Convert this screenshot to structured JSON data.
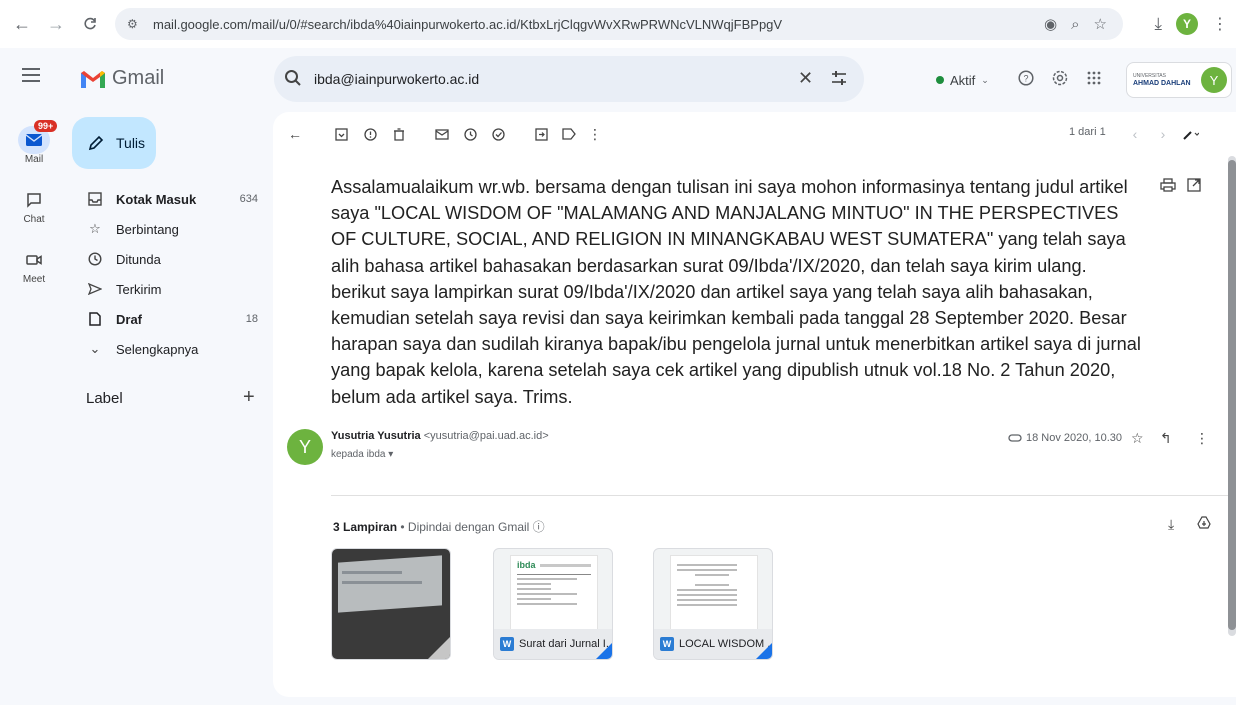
{
  "browser": {
    "url": "mail.google.com/mail/u/0/#search/ibda%40iainpurwokerto.ac.id/KtbxLrjClqgvWvXRwPRWNcVLNWqjFBPpgV",
    "profile_initial": "Y"
  },
  "header": {
    "app_name": "Gmail",
    "search_query": "ibda@iainpurwokerto.ac.id",
    "status": "Aktif",
    "brand_line1": "UNIVERSITAS",
    "brand_line2": "AHMAD DAHLAN",
    "avatar_initial": "Y"
  },
  "rail": {
    "mail_label": "Mail",
    "mail_badge": "99+",
    "chat_label": "Chat",
    "meet_label": "Meet"
  },
  "sidebar": {
    "compose_label": "Tulis",
    "items": [
      {
        "label": "Kotak Masuk",
        "count": "634",
        "icon": "inbox-icon"
      },
      {
        "label": "Berbintang",
        "count": "",
        "icon": "star-icon"
      },
      {
        "label": "Ditunda",
        "count": "",
        "icon": "clock-icon"
      },
      {
        "label": "Terkirim",
        "count": "",
        "icon": "send-icon"
      },
      {
        "label": "Draf",
        "count": "18",
        "icon": "draft-icon"
      },
      {
        "label": "Selengkapnya",
        "count": "",
        "icon": "chevron-down-icon"
      }
    ],
    "label_heading": "Label"
  },
  "toolbar": {
    "pager": "1 dari 1"
  },
  "message": {
    "body": "Assalamualaikum wr.wb. bersama dengan tulisan ini saya mohon informasinya tentang judul artikel saya \"LOCAL WISDOM OF \"MALAMANG AND MANJALANG MINTUO\" IN THE PERSPECTIVES OF CULTURE, SOCIAL, AND RELIGION IN MINANGKABAU WEST SUMATERA\" yang telah saya alih bahasa artikel bahasakan berdasarkan surat 09/Ibda'/IX/2020, dan telah saya kirim ulang. berikut saya lampirkan surat 09/Ibda'/IX/2020 dan artikel saya yang telah saya alih bahasakan, kemudian setelah saya revisi dan saya keirimkan kembali pada tanggal 28 September 2020. Besar harapan saya dan sudilah kiranya bapak/ibu pengelola jurnal untuk menerbitkan artikel saya di jurnal yang bapak kelola, karena setelah saya cek artikel yang dipublish utnuk vol.18 No. 2 Tahun 2020, belum ada artikel saya. Trims.",
    "sender_name": "Yusutria Yusutria",
    "sender_email": "<yusutria@pai.uad.ac.id>",
    "sender_initial": "Y",
    "to_line": "kepada ibda",
    "date": "18 Nov 2020, 10.30"
  },
  "attachments": {
    "count_label": "3 Lampiran",
    "scan_note": "Dipindai dengan Gmail",
    "files": [
      {
        "name": "",
        "type": "image"
      },
      {
        "name": "Surat dari Jurnal I...",
        "type": "word"
      },
      {
        "name": "LOCAL WISDOM ...",
        "type": "word"
      }
    ]
  },
  "colors": {
    "accent": "#c2e7ff",
    "avatar": "#6db33f",
    "badge": "#d93025",
    "word": "#2b7cd3"
  }
}
